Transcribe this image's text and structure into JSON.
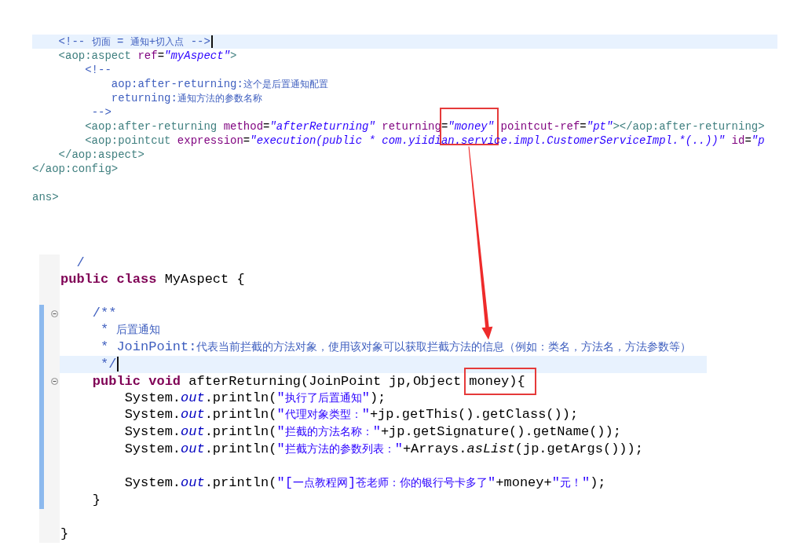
{
  "xml_editor": {
    "lines": [
      {
        "kind": "code",
        "highlighted": true,
        "tokens": [
          {
            "kind": "comment",
            "text": "    <!-- 切面 = 通知+切入点 -->"
          }
        ]
      },
      {
        "kind": "code",
        "highlighted": false,
        "tokens": [
          {
            "kind": "tag",
            "text": "    <aop:aspect"
          },
          {
            "kind": "attr",
            "text": " ref"
          },
          {
            "kind": "plain",
            "text": "="
          },
          {
            "kind": "value",
            "text": "\"myAspect\""
          },
          {
            "kind": "tag",
            "text": ">"
          }
        ]
      },
      {
        "kind": "code",
        "highlighted": false,
        "tokens": [
          {
            "kind": "comment",
            "text": "        <!--"
          }
        ]
      },
      {
        "kind": "code",
        "highlighted": false,
        "tokens": [
          {
            "kind": "comment",
            "text": "            aop:after-returning:这个是后置通知配置"
          }
        ]
      },
      {
        "kind": "code",
        "highlighted": false,
        "tokens": [
          {
            "kind": "comment",
            "text": "            returning:通知方法的参数名称"
          }
        ]
      },
      {
        "kind": "code",
        "highlighted": false,
        "tokens": [
          {
            "kind": "comment",
            "text": "         -->"
          }
        ]
      },
      {
        "kind": "code",
        "highlighted": false,
        "tokens": [
          {
            "kind": "tag",
            "text": "        <aop:after-returning"
          },
          {
            "kind": "attr",
            "text": " method"
          },
          {
            "kind": "plain",
            "text": "="
          },
          {
            "kind": "value",
            "text": "\"afterReturning\""
          },
          {
            "kind": "attr",
            "text": " returning"
          },
          {
            "kind": "callout",
            "tokens": [
              {
                "kind": "plain",
                "text": "="
              },
              {
                "kind": "value",
                "text": "\"money\""
              }
            ]
          },
          {
            "kind": "attr",
            "text": " pointcut-ref"
          },
          {
            "kind": "plain",
            "text": "="
          },
          {
            "kind": "value",
            "text": "\"pt\""
          },
          {
            "kind": "tag",
            "text": "></aop:after-returning>"
          }
        ]
      },
      {
        "kind": "code",
        "highlighted": false,
        "tokens": [
          {
            "kind": "tag",
            "text": "        <aop:pointcut"
          },
          {
            "kind": "attr",
            "text": " expression"
          },
          {
            "kind": "plain",
            "text": "="
          },
          {
            "kind": "value",
            "text": "\"execution(public * com.yiidian.service.impl.CustomerServiceImpl.*(..))\""
          },
          {
            "kind": "attr",
            "text": " id"
          },
          {
            "kind": "plain",
            "text": "="
          },
          {
            "kind": "value",
            "text": "\"p"
          }
        ]
      },
      {
        "kind": "code",
        "highlighted": false,
        "tokens": [
          {
            "kind": "tag",
            "text": "    </aop:aspect>"
          }
        ]
      },
      {
        "kind": "code",
        "highlighted": false,
        "tokens": [
          {
            "kind": "tag",
            "text": "</aop:config>"
          }
        ]
      },
      {
        "kind": "blank"
      },
      {
        "kind": "code",
        "highlighted": false,
        "tokens": [
          {
            "kind": "tag",
            "text": "ans>"
          }
        ]
      }
    ]
  },
  "java_editor": {
    "lines_before": [
      {
        "kind": "code",
        "highlighted": false,
        "fold": false,
        "tokens": [
          {
            "kind": "comment",
            "text": "  /"
          }
        ]
      },
      {
        "kind": "code",
        "highlighted": false,
        "fold": false,
        "tokens": [
          {
            "kind": "keyword",
            "text": "public"
          },
          {
            "kind": "keyword",
            "text": " class"
          },
          {
            "kind": "plain",
            "text": " MyAspect {"
          }
        ]
      },
      {
        "kind": "blank"
      }
    ],
    "marked_block": {
      "marked": true,
      "lines": [
        {
          "kind": "code",
          "highlighted": false,
          "fold": true,
          "tokens": [
            {
              "kind": "comment",
              "text": "    /**"
            }
          ]
        },
        {
          "kind": "code",
          "highlighted": false,
          "fold": false,
          "tokens": [
            {
              "kind": "comment",
              "text": "     * 后置通知"
            }
          ]
        },
        {
          "kind": "code",
          "highlighted": false,
          "fold": false,
          "tokens": [
            {
              "kind": "comment",
              "text": "     * JoinPoint:代表当前拦截的方法对象，使用该对象可以获取拦截方法的信息（例如：类名，方法名，方法参数等）"
            }
          ]
        },
        {
          "kind": "code",
          "highlighted": true,
          "fold": false,
          "tokens": [
            {
              "kind": "comment",
              "text": "     */"
            }
          ]
        },
        {
          "kind": "code",
          "highlighted": false,
          "fold": true,
          "tokens": [
            {
              "kind": "keyword",
              "text": "    public"
            },
            {
              "kind": "keyword",
              "text": " void"
            },
            {
              "kind": "plain",
              "text": " afterReturning(JoinPoint jp,Object "
            },
            {
              "kind": "callout",
              "tokens": [
                {
                  "kind": "plain",
                  "text": "money){"
                }
              ]
            }
          ]
        },
        {
          "kind": "code",
          "highlighted": false,
          "fold": false,
          "tokens": [
            {
              "kind": "plain",
              "text": "        System."
            },
            {
              "kind": "field",
              "text": "out"
            },
            {
              "kind": "plain",
              "text": ".println("
            },
            {
              "kind": "string",
              "text": "\"执行了后置通知\""
            },
            {
              "kind": "plain",
              "text": ");"
            }
          ]
        },
        {
          "kind": "code",
          "highlighted": false,
          "fold": false,
          "tokens": [
            {
              "kind": "plain",
              "text": "        System."
            },
            {
              "kind": "field",
              "text": "out"
            },
            {
              "kind": "plain",
              "text": ".println("
            },
            {
              "kind": "string",
              "text": "\"代理对象类型：\""
            },
            {
              "kind": "plain",
              "text": "+jp.getThis().getClass());"
            }
          ]
        },
        {
          "kind": "code",
          "highlighted": false,
          "fold": false,
          "tokens": [
            {
              "kind": "plain",
              "text": "        System."
            },
            {
              "kind": "field",
              "text": "out"
            },
            {
              "kind": "plain",
              "text": ".println("
            },
            {
              "kind": "string",
              "text": "\"拦截的方法名称：\""
            },
            {
              "kind": "plain",
              "text": "+jp.getSignature().getName());"
            }
          ]
        },
        {
          "kind": "code",
          "highlighted": false,
          "fold": false,
          "tokens": [
            {
              "kind": "plain",
              "text": "        System."
            },
            {
              "kind": "field",
              "text": "out"
            },
            {
              "kind": "plain",
              "text": ".println("
            },
            {
              "kind": "string",
              "text": "\"拦截方法的参数列表：\""
            },
            {
              "kind": "plain",
              "text": "+Arrays."
            },
            {
              "kind": "static",
              "text": "asList"
            },
            {
              "kind": "plain",
              "text": "(jp.getArgs()));"
            }
          ]
        },
        {
          "kind": "blank"
        },
        {
          "kind": "code",
          "highlighted": false,
          "fold": false,
          "tokens": [
            {
              "kind": "plain",
              "text": "        System."
            },
            {
              "kind": "field",
              "text": "out"
            },
            {
              "kind": "plain",
              "text": ".println("
            },
            {
              "kind": "string",
              "text": "\"[一点教程网]苍老师：你的银行号卡多了\""
            },
            {
              "kind": "plain",
              "text": "+money+"
            },
            {
              "kind": "string",
              "text": "\"元！\""
            },
            {
              "kind": "plain",
              "text": ");"
            }
          ]
        },
        {
          "kind": "code",
          "highlighted": false,
          "fold": false,
          "tokens": [
            {
              "kind": "plain",
              "text": "    }"
            }
          ]
        }
      ]
    },
    "lines_after": [
      {
        "kind": "blank"
      },
      {
        "kind": "code",
        "highlighted": false,
        "fold": false,
        "tokens": [
          {
            "kind": "plain",
            "text": "}"
          }
        ]
      }
    ]
  },
  "annotations": [
    {
      "kind": "arrow"
    }
  ]
}
